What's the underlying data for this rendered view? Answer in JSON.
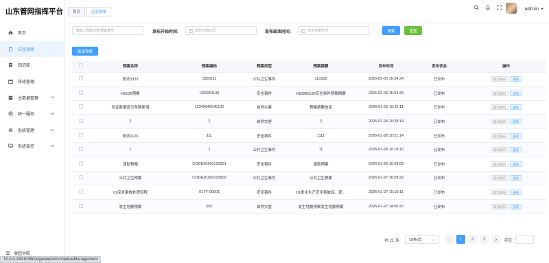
{
  "app": {
    "title": "山东管网指挥平台"
  },
  "sidebar": {
    "items": [
      {
        "label": "首页",
        "icon": "home-icon",
        "active": false,
        "has_children": false
      },
      {
        "label": "应急预案",
        "icon": "clipboard-icon",
        "active": true,
        "has_children": false
      },
      {
        "label": "知识库",
        "icon": "book-icon",
        "active": false,
        "has_children": false
      },
      {
        "label": "排班管理",
        "icon": "calendar-icon",
        "active": false,
        "has_children": false
      },
      {
        "label": "主数据管理",
        "icon": "database-icon",
        "active": false,
        "has_children": true
      },
      {
        "label": "统一服务",
        "icon": "service-icon",
        "active": false,
        "has_children": true
      },
      {
        "label": "系统管理",
        "icon": "gear-icon",
        "active": false,
        "has_children": true
      },
      {
        "label": "系统监控",
        "icon": "monitor-icon",
        "active": false,
        "has_children": true
      }
    ],
    "bottom_label": "收起导航"
  },
  "tabs": [
    {
      "label": "首页",
      "active": false
    },
    {
      "label": "应急预案",
      "active": true
    }
  ],
  "header": {
    "username": "admin"
  },
  "search": {
    "keyword_placeholder": "请输入预案名称/预案编号",
    "start_label": "发布开始时间:",
    "start_placeholder": "发布开始时间",
    "end_label": "发布结束时间:",
    "end_placeholder": "发布结束时间",
    "search_button": "搜索",
    "reset_button": "重置"
  },
  "toolbar": {
    "add_button": "新增预案"
  },
  "table": {
    "headers": [
      "预案名称",
      "预案编码",
      "预案类型",
      "预案摘要",
      "发布时间",
      "发布状态",
      "操作"
    ],
    "action_unpublish": "取消发布",
    "action_view": "查看",
    "rows": [
      {
        "name": "测试3333",
        "code": "3333111",
        "type": "公共卫生事件",
        "summary": "113333",
        "time": "2026-02-06 15:34:34",
        "status": "已发布"
      },
      {
        "name": "H0130预案",
        "code": "H20260130",
        "type": "安全事件",
        "summary": "H20260130安全事件预案摘要",
        "time": "2026-02-06 15:34:33",
        "status": "已发布"
      },
      {
        "name": "验证数据显示条数新增",
        "code": "12345646545132",
        "type": "自然灾害",
        "summary": "预案摘要信息",
        "time": "2026-01-29 10:31:11",
        "status": "已发布"
      },
      {
        "name": "2",
        "code": "2",
        "type": "自然灾害",
        "summary": "2",
        "time": "2026-01-28 10:28:14",
        "status": "已发布"
      },
      {
        "name": "测试0126",
        "code": "111",
        "type": "安全事件",
        "summary": "1111",
        "time": "2026-01-28 10:21:14",
        "status": "已发布"
      },
      {
        "name": "1",
        "code": "1",
        "type": "公共卫生事件",
        "summary": "11",
        "time": "2026-01-28 10:18:10",
        "status": "已发布"
      },
      {
        "name": "演助预案",
        "code": "CODE20260123001",
        "type": "安全事件",
        "summary": "演助预案",
        "time": "2026-01-28 10:28:08",
        "status": "已发布"
      },
      {
        "name": "公共卫生预案",
        "code": "CODE20260123002",
        "type": "公共卫生事件",
        "summary": "公共卫生预案",
        "time": "2026-01-27 16:28:22",
        "status": "已发布"
      },
      {
        "name": "01突发事故处理流程",
        "code": "01TF-00001",
        "type": "安全事件",
        "summary": "01发生生产安全事故后。现...",
        "time": "2026-01-27 15:10:11",
        "status": "已发布"
      },
      {
        "name": "发生地震预案",
        "code": "001",
        "type": "自然灾害",
        "summary": "发生地震预案发生地震预案",
        "time": "2026-01-27 14:06:20",
        "status": "已发布"
      }
    ]
  },
  "pagination": {
    "total_text": "共 21 条",
    "page_size": "10条/页",
    "pages": [
      "1",
      "2",
      "3"
    ],
    "current_page": "1",
    "goto_label": "前往"
  },
  "status_url": "10.0.0.249:8085/sdgw/web/#/scheduleManagement"
}
